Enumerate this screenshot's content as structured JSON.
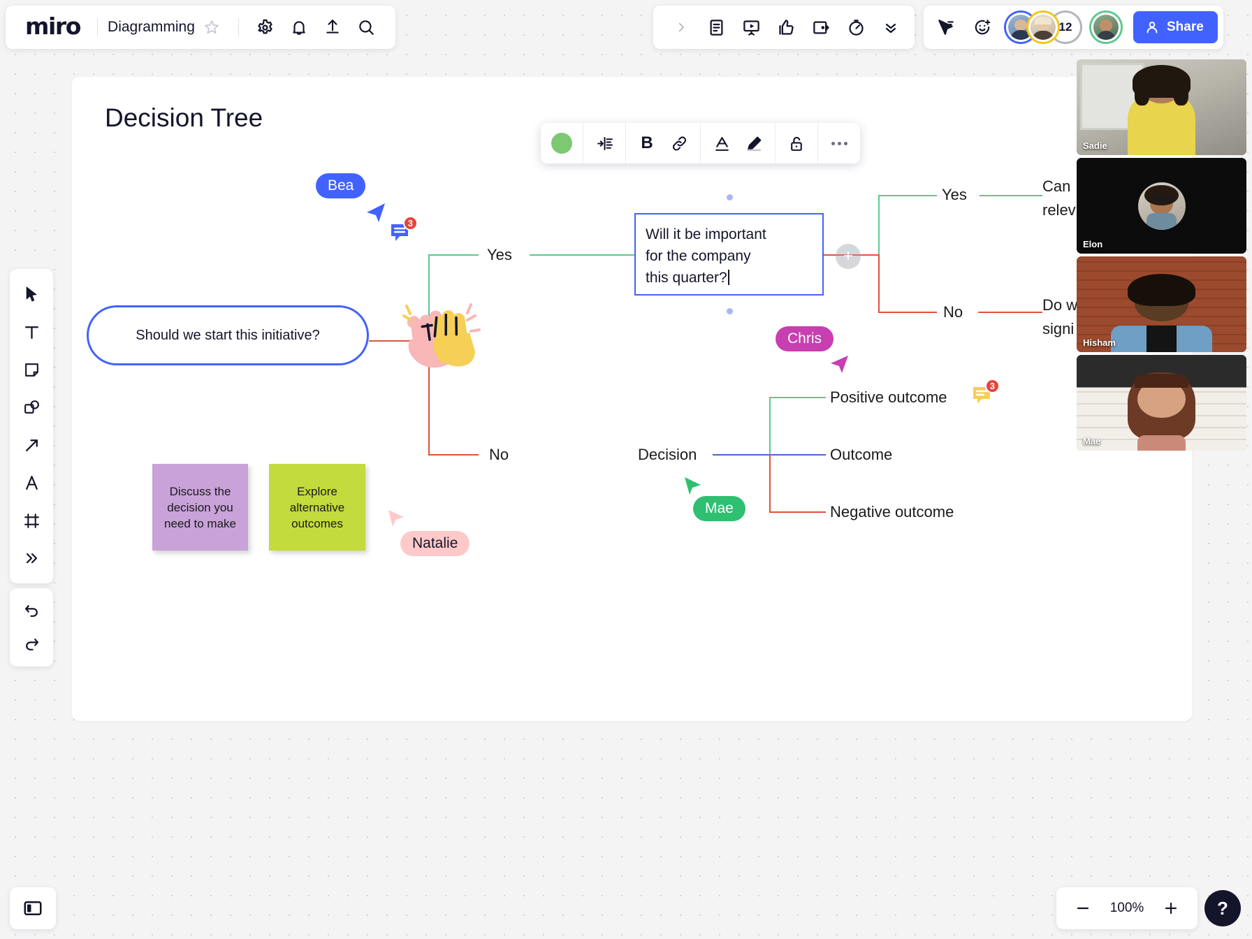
{
  "app": {
    "logo": "miro",
    "board_name": "Diagramming",
    "zoom_level": "100%",
    "help_label": "?"
  },
  "header_icons": [
    {
      "name": "star-icon",
      "glyph": "star"
    },
    {
      "name": "settings-gear-icon",
      "glyph": "gear"
    },
    {
      "name": "notifications-bell-icon",
      "glyph": "bell"
    },
    {
      "name": "upload-icon",
      "glyph": "upload"
    },
    {
      "name": "search-icon",
      "glyph": "search"
    }
  ],
  "center_toolbar": {
    "expand_label": "›",
    "icons": [
      {
        "name": "notes-icon",
        "glyph": "document"
      },
      {
        "name": "presentation-icon",
        "glyph": "presentation"
      },
      {
        "name": "reactions-thumbs-up-icon",
        "glyph": "thumbs-up"
      },
      {
        "name": "screen-share-icon",
        "glyph": "screen-share"
      },
      {
        "name": "timer-icon",
        "glyph": "timer"
      },
      {
        "name": "collapse-chevrons-icon",
        "glyph": "chevrons-down"
      }
    ]
  },
  "right_toolbar": {
    "icons": [
      {
        "name": "cursor-follow-icon",
        "glyph": "cursor-pointer"
      },
      {
        "name": "add-reaction-icon",
        "glyph": "smiley-plus"
      }
    ],
    "extra_collaborators_count": "12",
    "share_label": "Share"
  },
  "tool_rail": [
    {
      "name": "select-tool",
      "glyph": "cursor"
    },
    {
      "name": "text-tool",
      "glyph": "T"
    },
    {
      "name": "sticky-note-tool",
      "glyph": "sticky"
    },
    {
      "name": "shapes-tool",
      "glyph": "shapes"
    },
    {
      "name": "connection-line-tool",
      "glyph": "arrow"
    },
    {
      "name": "pen-tool",
      "glyph": "pen"
    },
    {
      "name": "frame-tool",
      "glyph": "frame"
    },
    {
      "name": "more-tools",
      "glyph": "chevrons-right"
    }
  ],
  "history_rail": [
    {
      "name": "undo-button",
      "glyph": "undo"
    },
    {
      "name": "redo-button",
      "glyph": "redo"
    }
  ],
  "format_toolbar": {
    "fill_color": "#7ec873",
    "buttons": [
      {
        "name": "fill-color-swatch",
        "glyph": "circle"
      },
      {
        "name": "text-align-icon",
        "glyph": "align"
      },
      {
        "name": "bold-button",
        "glyph": "B"
      },
      {
        "name": "link-button",
        "glyph": "link"
      },
      {
        "name": "text-color-button",
        "glyph": "A-underline"
      },
      {
        "name": "highlight-pen-button",
        "glyph": "pen"
      },
      {
        "name": "lock-button",
        "glyph": "padlock-open"
      },
      {
        "name": "more-options-button",
        "glyph": "ellipsis"
      }
    ]
  },
  "board": {
    "title": "Decision Tree",
    "root_node": "Should we start this initiative?",
    "selected_textbox": {
      "line1": "Will it be important",
      "line2": "for the company",
      "line3": "this quarter?"
    },
    "labels": {
      "yes_left": "Yes",
      "no_left": "No",
      "yes_right": "Yes",
      "no_right": "No",
      "decision": "Decision",
      "outcome": "Outcome",
      "positive_outcome": "Positive outcome",
      "negative_outcome": "Negative outcome",
      "clipped_top_line1": "Can",
      "clipped_top_line2": "relev",
      "clipped_bottom_line1": "Do w",
      "clipped_bottom_line2": "signi"
    },
    "sticky_notes": [
      {
        "text": "Discuss the decision you need to make",
        "color": "#c8a2d8"
      },
      {
        "text": "Explore alternative outcomes",
        "color": "#c3db3c"
      }
    ],
    "comment_badges": [
      "3",
      "3"
    ],
    "cursors": [
      {
        "name": "Bea",
        "color": "#4262ff",
        "text_color": "#ffffff"
      },
      {
        "name": "Chris",
        "color": "#c73fb0",
        "text_color": "#ffffff"
      },
      {
        "name": "Mae",
        "color": "#2fbf71",
        "text_color": "#ffffff"
      },
      {
        "name": "Natalie",
        "color": "#ffc9c9",
        "text_color": "#14142b"
      }
    ]
  },
  "video_panel": [
    {
      "name": "Sadie",
      "muted_avatar": false
    },
    {
      "name": "Elon",
      "muted_avatar": true
    },
    {
      "name": "Hisham",
      "muted_avatar": false
    },
    {
      "name": "Mae",
      "muted_avatar": false
    }
  ],
  "zoom_controls": {
    "minus": "−",
    "value": "100%",
    "plus": "+"
  }
}
